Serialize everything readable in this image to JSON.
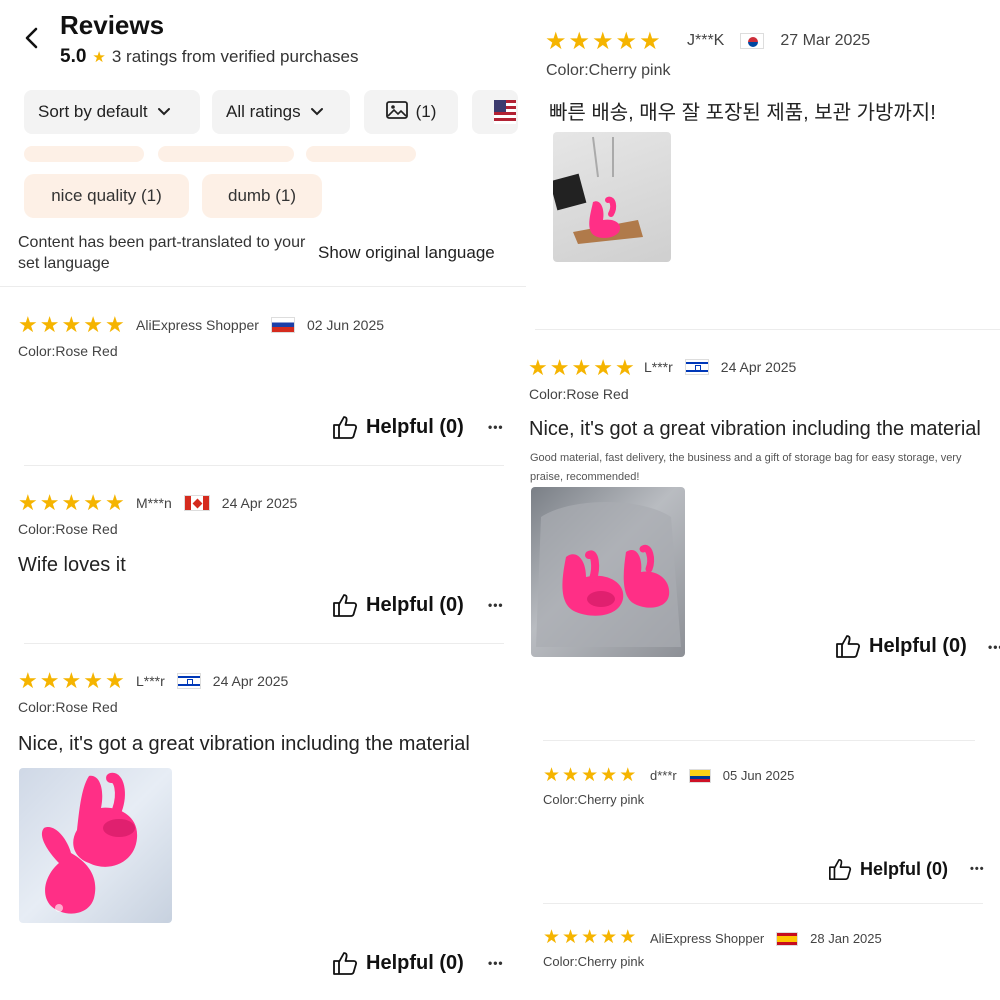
{
  "header": {
    "title": "Reviews",
    "score": "5.0",
    "ratings_text": "3 ratings from verified purchases"
  },
  "filters": {
    "sort_label": "Sort by default",
    "ratings_label": "All ratings",
    "photo_count": "(1)"
  },
  "tags": [
    {
      "label": "nice quality (1)"
    },
    {
      "label": "dumb (1)"
    }
  ],
  "translation": {
    "note": "Content has been part-translated to your set language",
    "show_original": "Show original language"
  },
  "reviews_left": [
    {
      "user": "AliExpress Shopper",
      "country": "Russia",
      "date": "02 Jun 2025",
      "color": "Color:Rose Red",
      "text": "",
      "helpful": "Helpful (0)",
      "rating": 5
    },
    {
      "user": "M***n",
      "country": "Canada",
      "date": "24 Apr 2025",
      "color": "Color:Rose Red",
      "text": "Wife loves it",
      "helpful": "Helpful (0)",
      "rating": 5
    },
    {
      "user": "L***r",
      "country": "Israel",
      "date": "24 Apr 2025",
      "color": "Color:Rose Red",
      "text": "Nice, it's got a great vibration including the material",
      "helpful": "Helpful (0)",
      "rating": 5
    }
  ],
  "reviews_right": [
    {
      "user": "J***K",
      "country": "South Korea",
      "date": "27 Mar 2025",
      "color": "Color:Cherry pink",
      "text": "빠른 배송, 매우 잘 포장된 제품, 보관 가방까지!",
      "rating": 5
    },
    {
      "user": "L***r",
      "country": "Israel",
      "date": "24 Apr 2025",
      "color": "Color:Rose Red",
      "text": "Nice, it's got a great vibration including the material",
      "original": "Good material, fast delivery, the business and a gift of storage bag for easy storage, very praise, recommended!",
      "helpful": "Helpful (0)",
      "rating": 5
    },
    {
      "user": "d***r",
      "country": "Colombia",
      "date": "05 Jun 2025",
      "color": "Color:Cherry pink",
      "helpful": "Helpful (0)",
      "rating": 5
    },
    {
      "user": "AliExpress Shopper",
      "country": "Spain",
      "date": "28 Jan 2025",
      "color": "Color:Cherry pink",
      "rating": 5
    }
  ],
  "more_glyph": "•••",
  "colors": {
    "star": "#f5b400",
    "tag_bg": "#fdf0e6",
    "chip_bg": "#f3f3f3",
    "product_pink": "#ff2f86"
  }
}
